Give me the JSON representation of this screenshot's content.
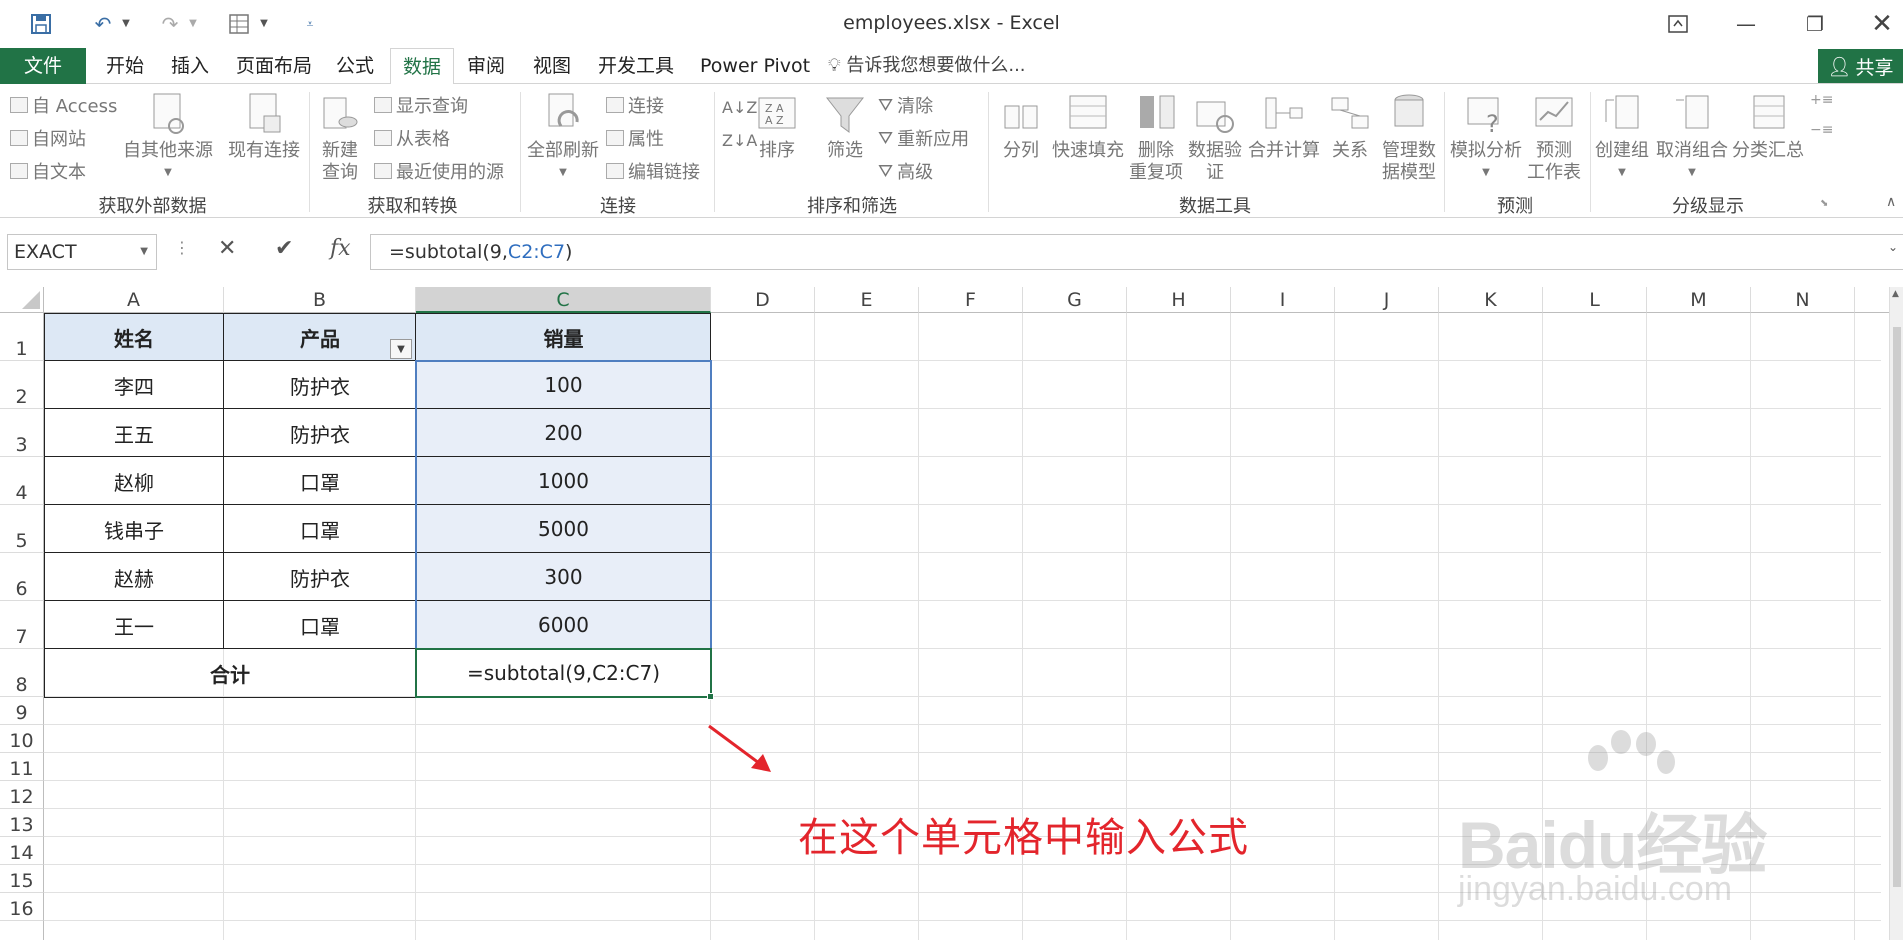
{
  "titlebar": {
    "title": "employees.xlsx - Excel",
    "quick_access": [
      "save-icon",
      "undo-icon",
      "redo-icon",
      "form-icon",
      "customize-icon"
    ]
  },
  "tabs": {
    "file": "文件",
    "items": [
      "开始",
      "插入",
      "页面布局",
      "公式",
      "数据",
      "审阅",
      "视图",
      "开发工具",
      "Power Pivot"
    ],
    "active": "数据",
    "tell_me": "告诉我您想要做什么...",
    "share": "共享"
  },
  "ribbon": {
    "get_external": {
      "label": "获取外部数据",
      "access": "自 Access",
      "web": "自网站",
      "text": "自文本",
      "other": "自其他来源",
      "existing": "现有连接"
    },
    "get_transform": {
      "label": "获取和转换",
      "new_query": "新建",
      "new_query_2": "查询",
      "show_queries": "显示查询",
      "from_table": "从表格",
      "recent": "最近使用的源"
    },
    "connections": {
      "label": "连接",
      "refresh_all": "全部刷新",
      "connections": "连接",
      "properties": "属性",
      "edit_links": "编辑链接"
    },
    "sort_filter": {
      "label": "排序和筛选",
      "sort": "排序",
      "filter": "筛选",
      "clear": "清除",
      "reapply": "重新应用",
      "advanced": "高级"
    },
    "data_tools": {
      "label": "数据工具",
      "text_to_columns": "分列",
      "flash_fill": "快速填充",
      "remove_dup_1": "删除",
      "remove_dup_2": "重复项",
      "validation_1": "数据验",
      "validation_2": "证",
      "consolidate": "合并计算",
      "relationships": "关系",
      "data_model_1": "管理数",
      "data_model_2": "据模型"
    },
    "forecast": {
      "label": "预测",
      "what_if": "模拟分析",
      "forecast_1": "预测",
      "forecast_2": "工作表"
    },
    "outline": {
      "label": "分级显示",
      "group": "创建组",
      "ungroup": "取消组合",
      "subtotal": "分类汇总"
    }
  },
  "formula_bar": {
    "name_box": "EXACT",
    "fx": "fx",
    "formula_prefix": "=subtotal(9,",
    "formula_ref": "C2:C7",
    "formula_suffix": ")"
  },
  "sheet": {
    "columns": [
      "A",
      "B",
      "C",
      "D",
      "E",
      "F",
      "G",
      "H",
      "I",
      "J",
      "K",
      "L",
      "M",
      "N"
    ],
    "rows": [
      "1",
      "2",
      "3",
      "4",
      "5",
      "6",
      "7",
      "8",
      "9",
      "10",
      "11",
      "12",
      "13",
      "14",
      "15",
      "16"
    ],
    "selected_column": "C",
    "headers": {
      "name": "姓名",
      "product": "产品",
      "sales": "销量"
    },
    "data": [
      {
        "name": "李四",
        "product": "防护衣",
        "sales": "100"
      },
      {
        "name": "王五",
        "product": "防护衣",
        "sales": "200"
      },
      {
        "name": "赵柳",
        "product": "口罩",
        "sales": "1000"
      },
      {
        "name": "钱串子",
        "product": "口罩",
        "sales": "5000"
      },
      {
        "name": "赵赫",
        "product": "防护衣",
        "sales": "300"
      },
      {
        "name": "王一",
        "product": "口罩",
        "sales": "6000"
      }
    ],
    "total_label": "合计",
    "total_formula": "=subtotal(9,C2:C7)"
  },
  "annotation": "在这个单元格中输入公式",
  "watermark": {
    "brand": "Baidu经验",
    "url": "jingyan.baidu.com"
  },
  "colors": {
    "accent": "#217346",
    "annotation": "#e3252c",
    "selection": "#e8eef8"
  }
}
